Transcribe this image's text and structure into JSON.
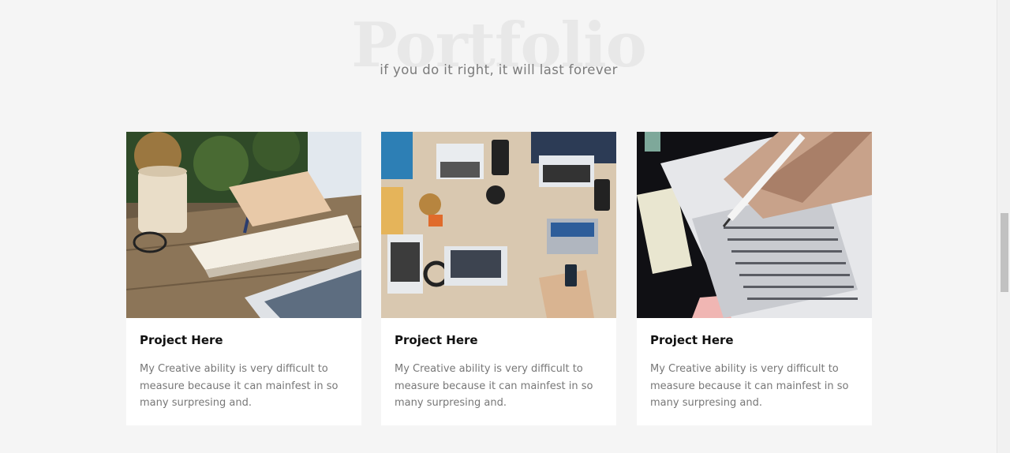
{
  "section": {
    "background_title": "Portfolio",
    "subtitle": "if you do it right, it will last forever"
  },
  "projects": [
    {
      "image": "notebook-writing-photo",
      "title": "Project Here",
      "description": "My Creative ability is very difficult to measure because it can mainfest in so many surpresing and."
    },
    {
      "image": "team-laptops-desk-photo",
      "title": "Project Here",
      "description": "My Creative ability is very difficult to measure because it can mainfest in so many surpresing and."
    },
    {
      "image": "answer-sheet-pen-photo",
      "title": "Project Here",
      "description": "My Creative ability is very difficult to measure because it can mainfest in so many surpresing and."
    }
  ],
  "colors": {
    "page_background": "#f5f5f5",
    "card_background": "#ffffff",
    "title_text": "#111111",
    "body_text": "#777777",
    "watermark_text": "#e8e8e8"
  }
}
